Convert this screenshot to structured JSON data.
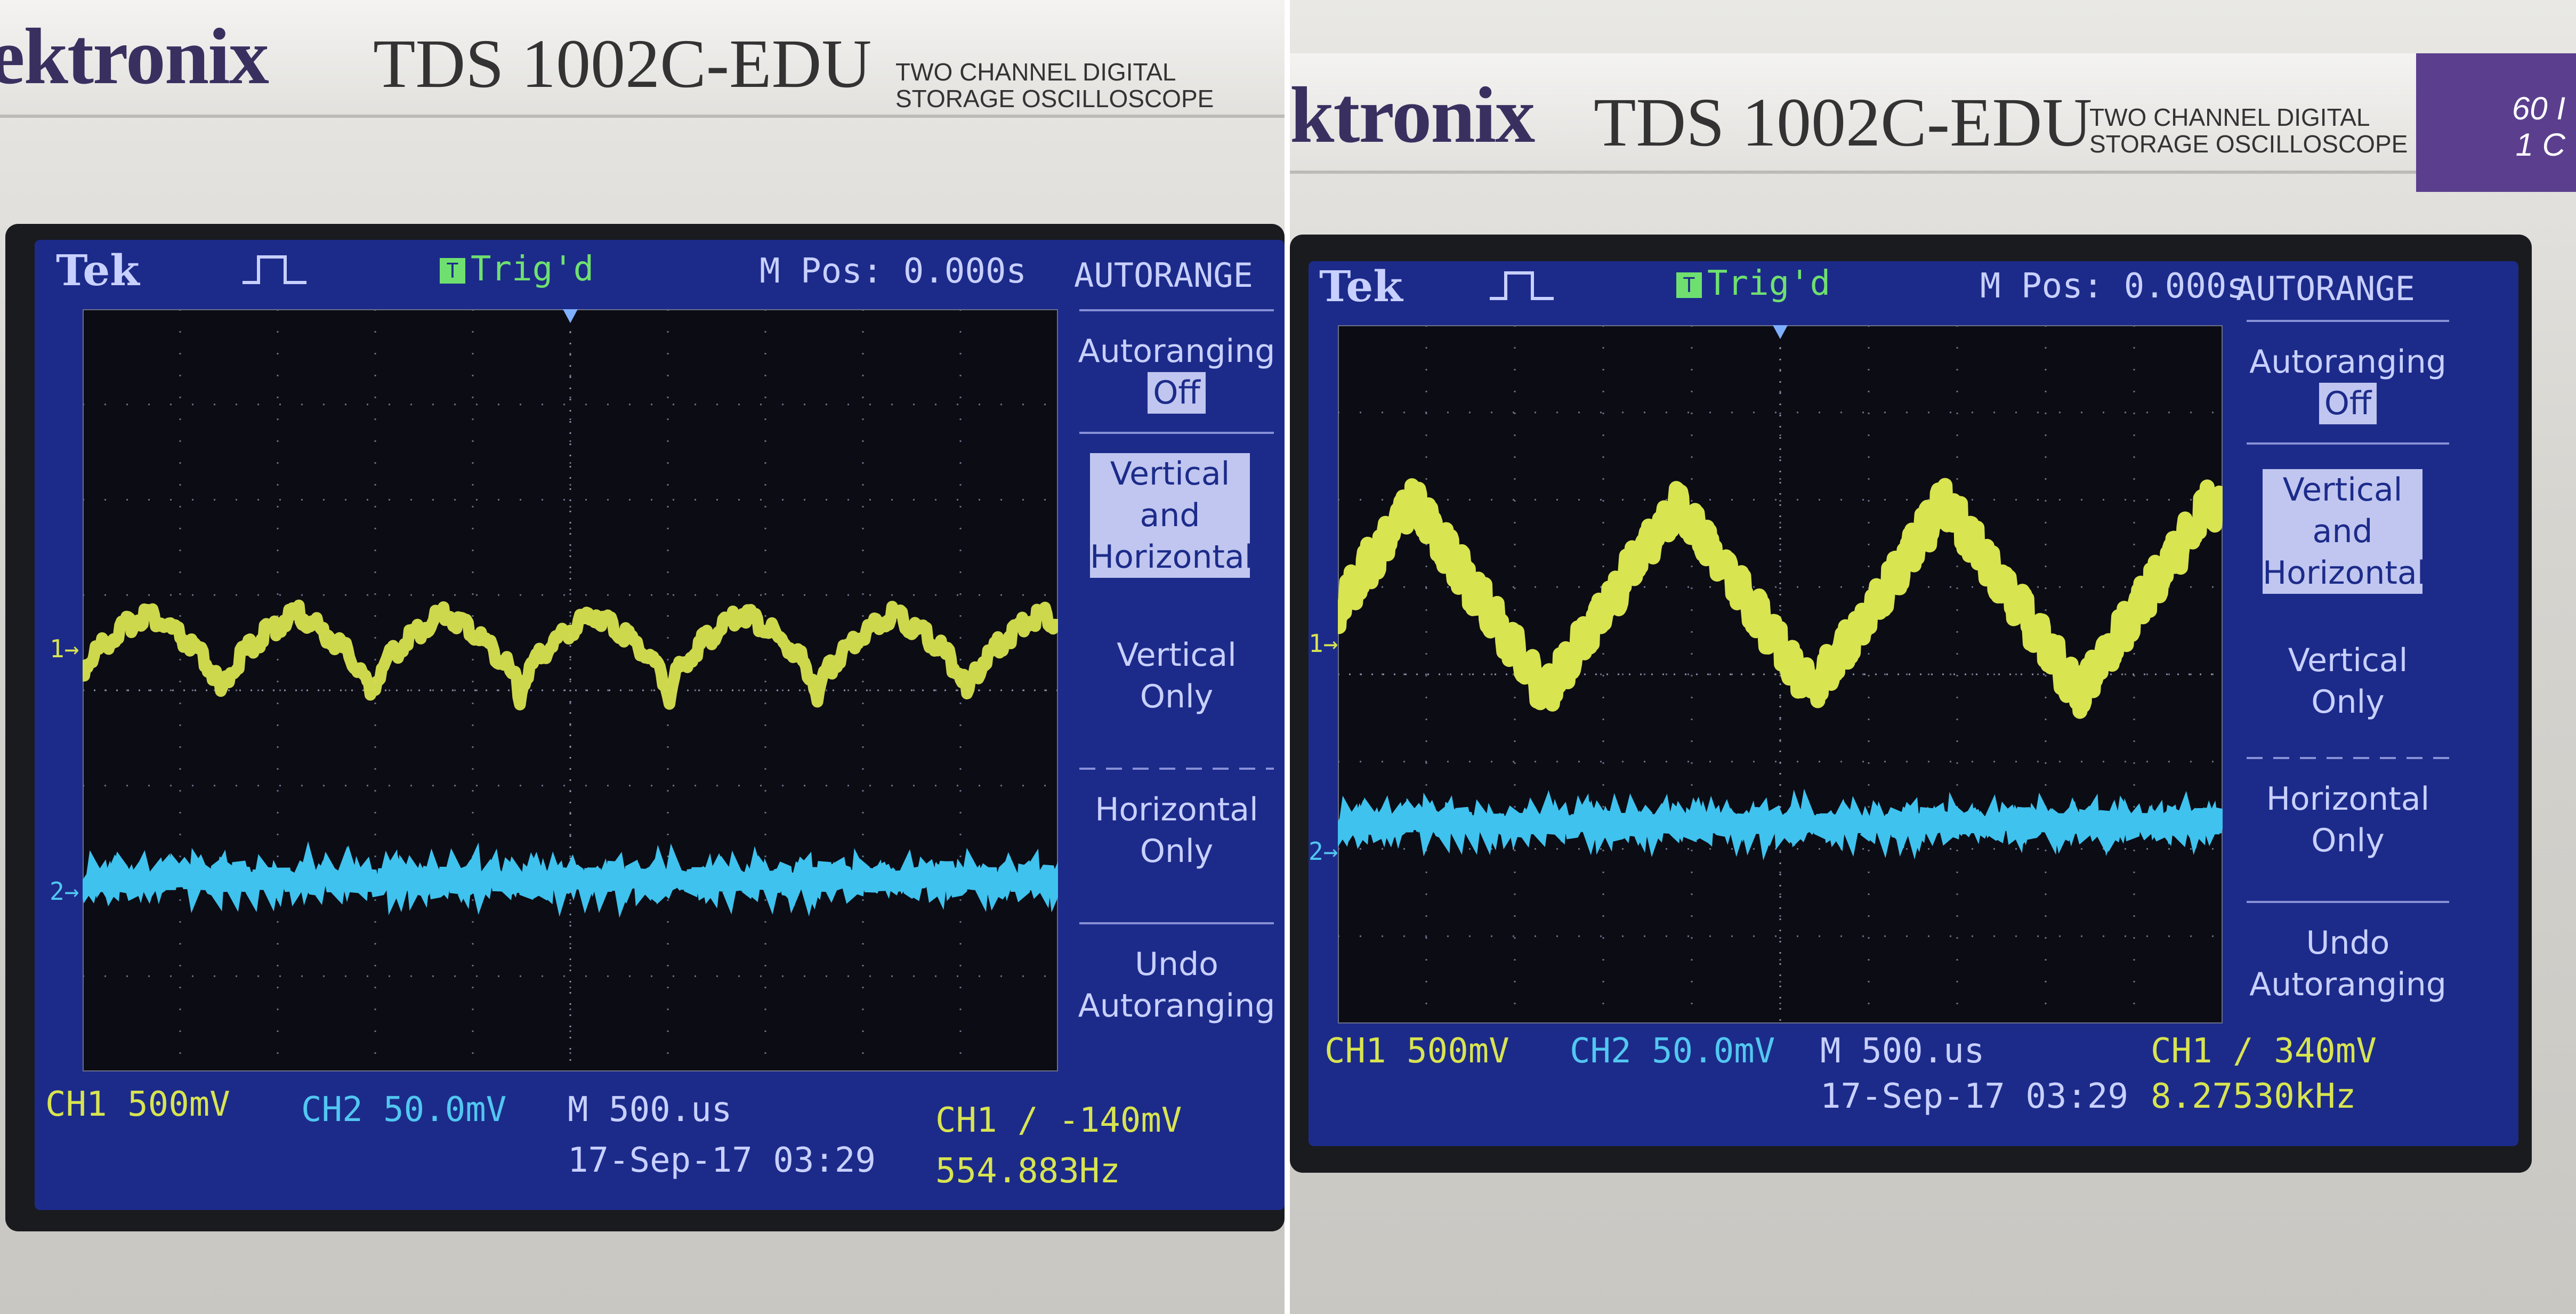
{
  "left": {
    "header": {
      "brand": "ektronix",
      "model": "TDS 1002C-EDU",
      "desc_line1": "TWO CHANNEL DIGITAL",
      "desc_line2": "STORAGE OSCILLOSCOPE"
    },
    "status": {
      "logo": "Tek",
      "trig_state": "Trig'd",
      "m_pos": "M Pos: 0.000s"
    },
    "menu": {
      "title": "AUTORANGE",
      "autoranging_label": "Autoranging",
      "autoranging_value": "Off",
      "item_vh_line1": "Vertical",
      "item_vh_line2": "and",
      "item_vh_line3": "Horizontal",
      "item_v_line1": "Vertical",
      "item_v_line2": "Only",
      "item_h_line1": "Horizontal",
      "item_h_line2": "Only",
      "item_undo_line1": "Undo",
      "item_undo_line2": "Autoranging"
    },
    "readout": {
      "ch1": "CH1  500mV",
      "ch2": "CH2  50.0mV",
      "timebase": "M 500.us",
      "trigger": "CH1 ∕ -140mV",
      "datetime": "17-Sep-17 03:29",
      "frequency": "554.883Hz"
    },
    "markers": {
      "ch1": "1→",
      "ch2": "2→"
    }
  },
  "right": {
    "header": {
      "brand": "ktronix",
      "model": "TDS 1002C-EDU",
      "desc_line1": "TWO CHANNEL DIGITAL",
      "desc_line2": "STORAGE OSCILLOSCOPE",
      "corner_line1": "60 I",
      "corner_line2": "1 C"
    },
    "status": {
      "logo": "Tek",
      "trig_state": "Trig'd",
      "m_pos": "M Pos: 0.000s"
    },
    "menu": {
      "title": "AUTORANGE",
      "autoranging_label": "Autoranging",
      "autoranging_value": "Off",
      "item_vh_line1": "Vertical",
      "item_vh_line2": "and",
      "item_vh_line3": "Horizontal",
      "item_v_line1": "Vertical",
      "item_v_line2": "Only",
      "item_h_line1": "Horizontal",
      "item_h_line2": "Only",
      "item_undo_line1": "Undo",
      "item_undo_line2": "Autoranging"
    },
    "readout": {
      "ch1": "CH1  500mV",
      "ch2": "CH2  50.0mV",
      "timebase": "M 500.us",
      "trigger": "CH1 ∕ 340mV",
      "datetime": "17-Sep-17 03:29",
      "frequency": "8.27530kHz"
    },
    "markers": {
      "ch1": "1→",
      "ch2": "2→"
    }
  },
  "colors": {
    "ch1_trace": "#d8e450",
    "ch2_trace": "#3fc2ee",
    "screen_bg": "#1c2b8a",
    "grid_bg": "#0c0c14",
    "brand": "#3a3060"
  }
}
